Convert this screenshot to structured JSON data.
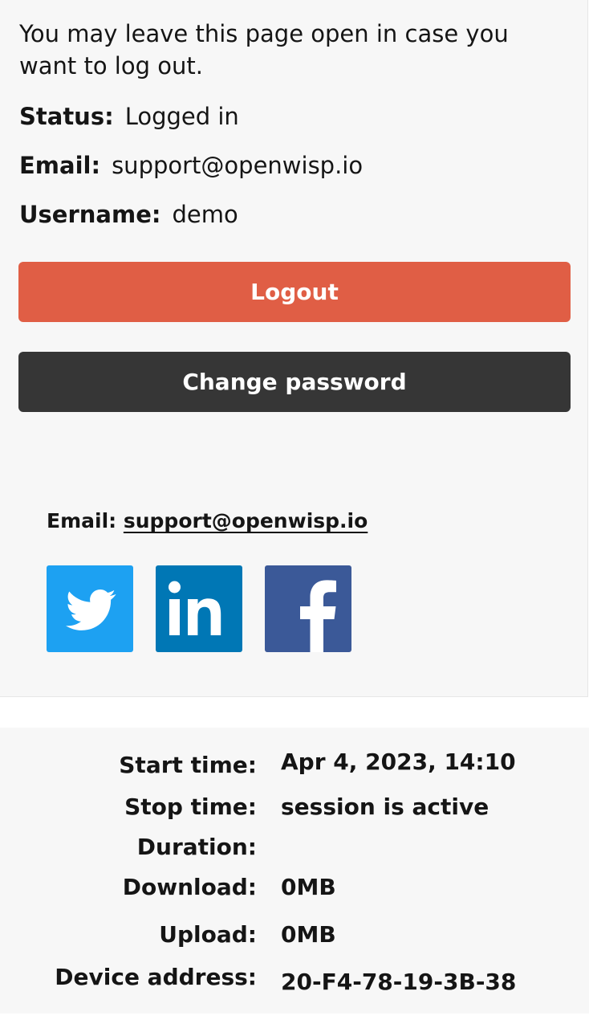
{
  "intro": "You may leave this page open in case you want to log out.",
  "status": {
    "label": "Status:",
    "value": "Logged in"
  },
  "email": {
    "label": "Email:",
    "value": "support@openwisp.io"
  },
  "username": {
    "label": "Username:",
    "value": "demo"
  },
  "buttons": {
    "logout": "Logout",
    "change_password": "Change password"
  },
  "footer": {
    "email_label": "Email:",
    "email_link": "support@openwisp.io",
    "social": [
      "twitter-icon",
      "linkedin-icon",
      "facebook-icon"
    ]
  },
  "session": {
    "start_time": {
      "label": "Start time:",
      "value": "Apr 4, 2023, 14:10"
    },
    "stop_time": {
      "label": "Stop time:",
      "value": "session is active"
    },
    "duration": {
      "label": "Duration:",
      "value": ""
    },
    "download": {
      "label": "Download:",
      "value": "0MB"
    },
    "upload": {
      "label": "Upload:",
      "value": "0MB"
    },
    "device_address": {
      "label": "Device address:",
      "value": "20-F4-78-19-3B-38"
    }
  },
  "colors": {
    "logout": "#e05e45",
    "change_password": "#363636",
    "twitter": "#1da1f2",
    "linkedin": "#0077b5",
    "facebook": "#3b5998",
    "panel_bg": "#f7f7f7"
  }
}
